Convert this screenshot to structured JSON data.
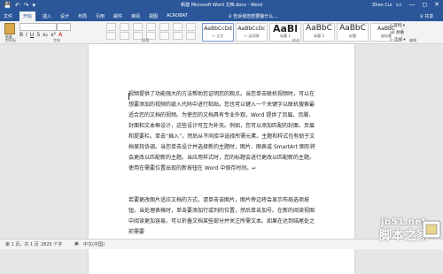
{
  "titlebar": {
    "title": "新建 Microsoft Word 文档.docx - Word",
    "user": "Zhen Cui",
    "qat": [
      "💾",
      "↶",
      "↷",
      "▾"
    ],
    "window_controls": [
      "▭",
      "—",
      "◻",
      "✕"
    ]
  },
  "tabs": [
    "文件",
    "开始",
    "插入",
    "设计",
    "布局",
    "引用",
    "邮件",
    "审阅",
    "视图",
    "ACROBAT"
  ],
  "tellme": "♀ 告诉我您想要做什么...",
  "share": "♀ 共享",
  "ribbon": {
    "paste_label": "粘贴",
    "styles": [
      {
        "sample": "AaBbCcDd",
        "name": "↵ 正文"
      },
      {
        "sample": "AaBbCcDc",
        "name": "↵ 无间隔"
      },
      {
        "sample": "AaBl",
        "name": "标题 1"
      },
      {
        "sample": "AaBbC",
        "name": "标题 2"
      },
      {
        "sample": "AaBbC",
        "name": "标题"
      },
      {
        "sample": "AaBbC",
        "name": "副标题"
      },
      {
        "sample": "AaBbCcDc",
        "name": "不明显强调"
      }
    ],
    "editing": [
      "ρ 查找 ▾",
      "ab 替换",
      "▷ 选择 ▾"
    ],
    "group_names": [
      "剪贴板",
      "字体",
      "段落",
      "样式",
      "编辑"
    ]
  },
  "document": {
    "paragraphs": [
      "视频提供了功能强大的方法帮助您证明您的观点。当您单击联机视频时，可以在想要添加的视频的嵌入代码中进行粘贴。您也可以键入一个关键字以联机搜索最适合您的文档的视频。为使您的文档具有专业外观，Word 提供了页眉、页脚、封面和文本框设计，这些设计可互为补充。例如，您可以添加匹配的封面、页眉和提要栏。单击“插入”，然后从不同库中选择所需元素。主题和样式也有助于文档保持协调。当您单击设计并选择新的主题时，图片、图表或 SmartArt 图形将会更改以匹配新的主题。当应用样式时，您的标题会进行更改以匹配新的主题。使用在需要位置出现的新按钮在 Word 中保存时间。↵",
      "若要更改图片适应文档的方式，请单击该图片，图片旁边将会显示布局选项按钮。当处理表格时，单击要添加行或列的位置，然后单击加号。在新的阅读视图中阅读更加容易。可以折叠文档某些部分并关注所需文本。如果在达到结尾处之前需要"
    ]
  },
  "statusbar": {
    "page": "第 1 页，共 1 页",
    "words": "2825 个字",
    "lang": "中文(中国)"
  },
  "watermark": {
    "site": "jb51.net",
    "brand": "脚本之家"
  }
}
